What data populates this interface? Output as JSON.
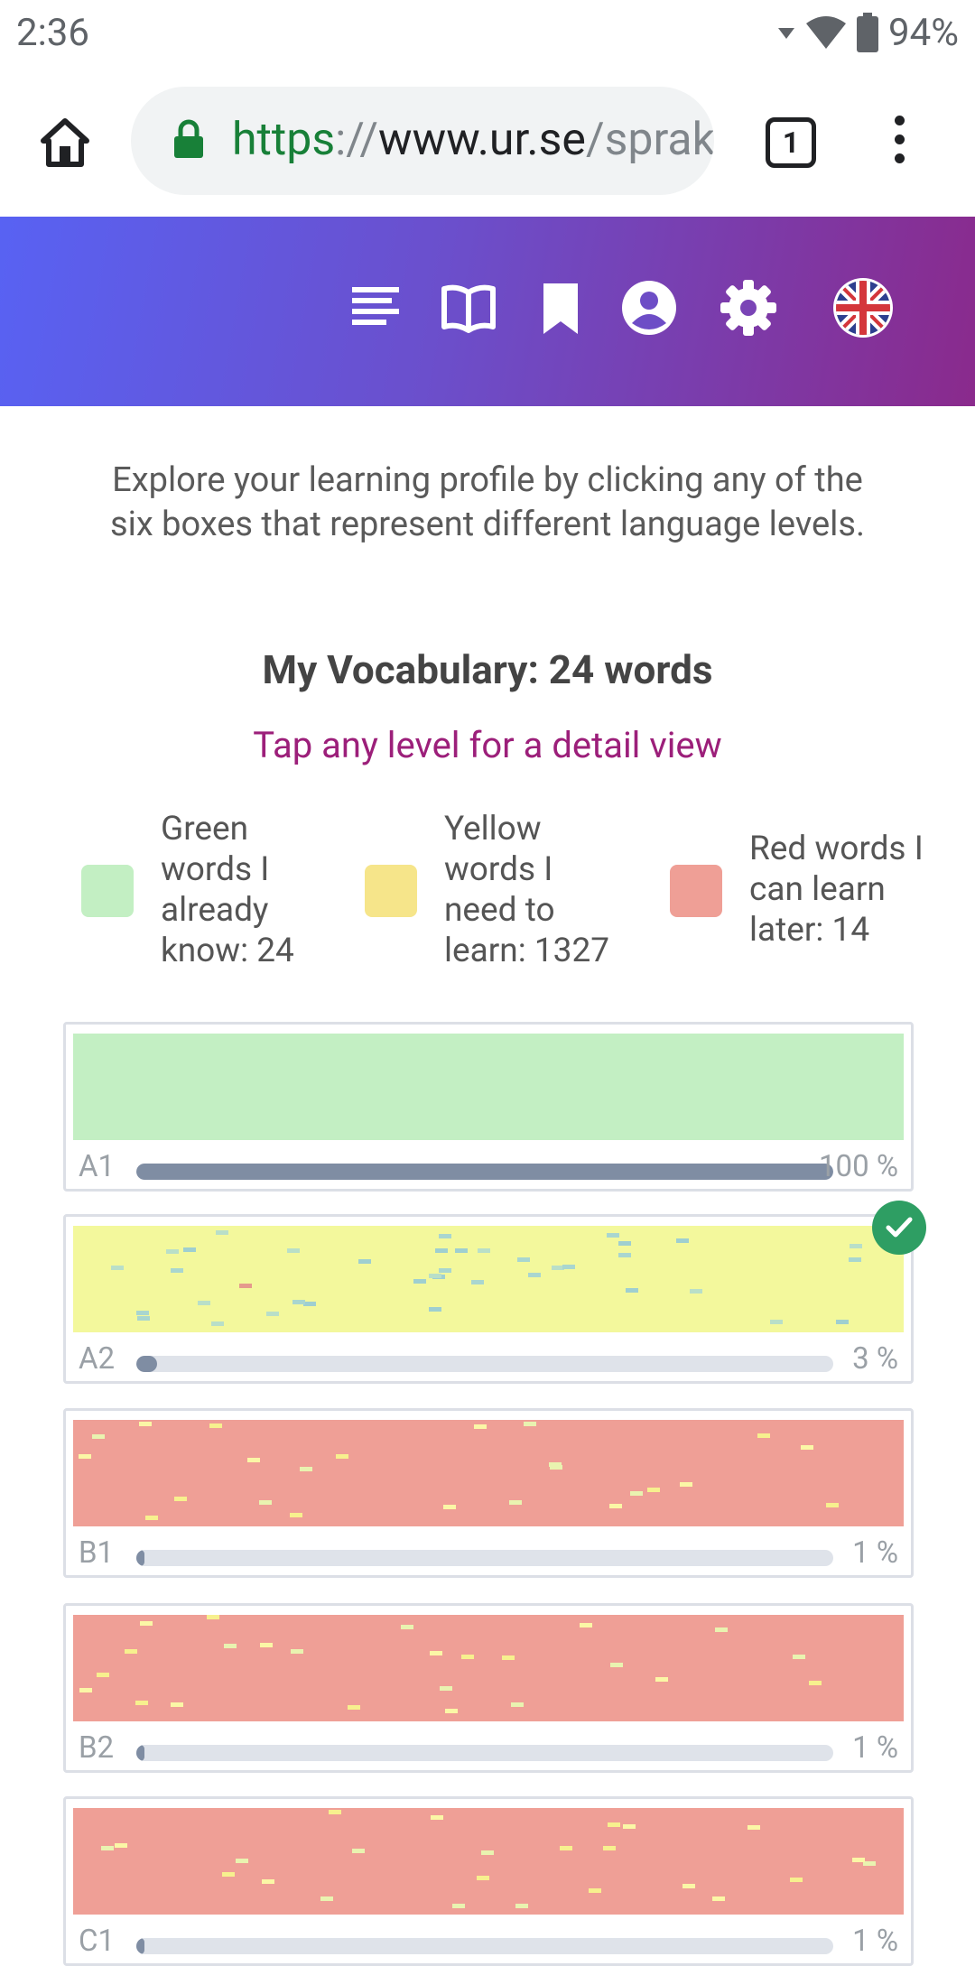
{
  "status_bar": {
    "time": "2:36",
    "battery": "94%"
  },
  "browser": {
    "url_scheme": "https",
    "url_sep": "://",
    "url_host": "www.ur.se",
    "url_path": "/sprak",
    "tab_count": "1"
  },
  "intro_text": "Explore your learning profile by clicking any of the six boxes that represent different language levels.",
  "vocabulary_title": "My Vocabulary: 24 words",
  "tap_hint": "Tap any level for a detail view",
  "legend": [
    {
      "text": "Green words I already know: 24",
      "color": "#c3efc3"
    },
    {
      "text": "Yellow words I need to learn: 1327",
      "color": "#f6e58a"
    },
    {
      "text": "Red words I can learn later: 14",
      "color": "#ef9f96"
    }
  ],
  "levels": [
    {
      "label": "A1",
      "percent": "100 %",
      "progress": 1.0,
      "color": "#c3efc3"
    },
    {
      "label": "A2",
      "percent": "3 %",
      "progress": 0.03,
      "color": "#f3f89c"
    },
    {
      "label": "B1",
      "percent": "1 %",
      "progress": 0.01,
      "color": "#ef9f96"
    },
    {
      "label": "B2",
      "percent": "1 %",
      "progress": 0.01,
      "color": "#ef9f96"
    },
    {
      "label": "C1",
      "percent": "1 %",
      "progress": 0.01,
      "color": "#ef9f96"
    }
  ]
}
